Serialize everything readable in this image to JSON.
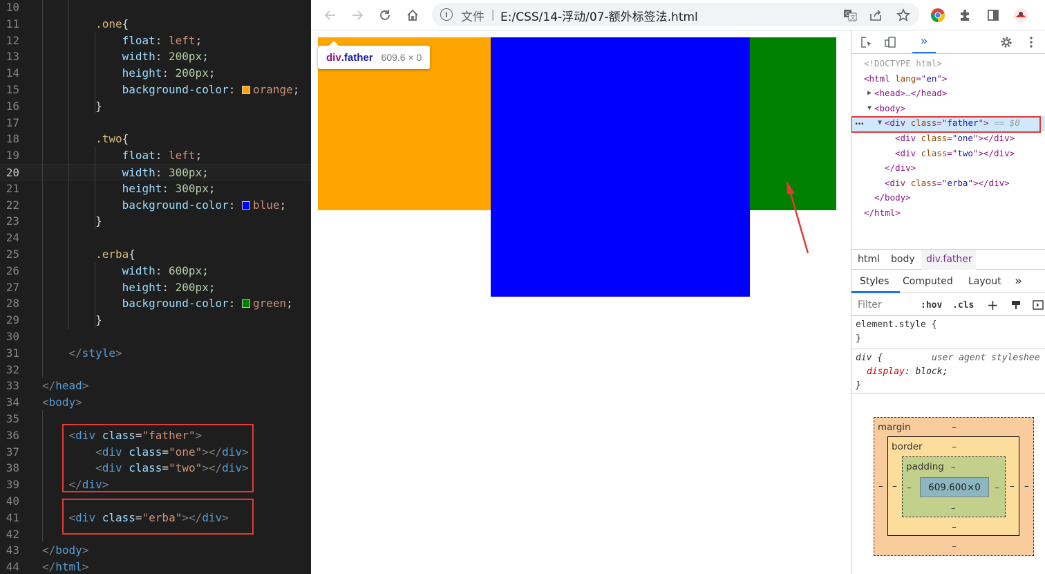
{
  "editor": {
    "lines": [
      {
        "n": "10",
        "tokens": []
      },
      {
        "n": "11",
        "tokens": [
          [
            "sel",
            "        .one"
          ],
          [
            "p",
            "{"
          ]
        ]
      },
      {
        "n": "12",
        "tokens": [
          [
            "prop",
            "            float"
          ],
          [
            "p",
            ": "
          ],
          [
            "val",
            "left"
          ],
          [
            "p",
            ";"
          ]
        ]
      },
      {
        "n": "13",
        "tokens": [
          [
            "prop",
            "            width"
          ],
          [
            "p",
            ": "
          ],
          [
            "num",
            "200px"
          ],
          [
            "p",
            ";"
          ]
        ]
      },
      {
        "n": "14",
        "tokens": [
          [
            "prop",
            "            height"
          ],
          [
            "p",
            ": "
          ],
          [
            "num",
            "200px"
          ],
          [
            "p",
            ";"
          ]
        ]
      },
      {
        "n": "15",
        "tokens": [
          [
            "prop",
            "            background-color"
          ],
          [
            "p",
            ": "
          ],
          [
            "swatch",
            "#ffa500"
          ],
          [
            "val",
            "orange"
          ],
          [
            "p",
            ";"
          ]
        ]
      },
      {
        "n": "16",
        "tokens": [
          [
            "p",
            "        }"
          ]
        ]
      },
      {
        "n": "17",
        "tokens": []
      },
      {
        "n": "18",
        "tokens": [
          [
            "sel",
            "        .two"
          ],
          [
            "p",
            "{"
          ]
        ]
      },
      {
        "n": "19",
        "tokens": [
          [
            "prop",
            "            float"
          ],
          [
            "p",
            ": "
          ],
          [
            "val",
            "left"
          ],
          [
            "p",
            ";"
          ]
        ]
      },
      {
        "n": "20",
        "tokens": [
          [
            "prop",
            "            width"
          ],
          [
            "p",
            ": "
          ],
          [
            "num",
            "300px"
          ],
          [
            "p",
            ";"
          ]
        ],
        "active": true
      },
      {
        "n": "21",
        "tokens": [
          [
            "prop",
            "            height"
          ],
          [
            "p",
            ": "
          ],
          [
            "num",
            "300px"
          ],
          [
            "p",
            ";"
          ]
        ]
      },
      {
        "n": "22",
        "tokens": [
          [
            "prop",
            "            background-color"
          ],
          [
            "p",
            ": "
          ],
          [
            "swatch",
            "#0000ff"
          ],
          [
            "val",
            "blue"
          ],
          [
            "p",
            ";"
          ]
        ]
      },
      {
        "n": "23",
        "tokens": [
          [
            "p",
            "        }"
          ]
        ]
      },
      {
        "n": "24",
        "tokens": []
      },
      {
        "n": "25",
        "tokens": [
          [
            "sel",
            "        .erba"
          ],
          [
            "p",
            "{"
          ]
        ]
      },
      {
        "n": "26",
        "tokens": [
          [
            "prop",
            "            width"
          ],
          [
            "p",
            ": "
          ],
          [
            "num",
            "600px"
          ],
          [
            "p",
            ";"
          ]
        ]
      },
      {
        "n": "27",
        "tokens": [
          [
            "prop",
            "            height"
          ],
          [
            "p",
            ": "
          ],
          [
            "num",
            "200px"
          ],
          [
            "p",
            ";"
          ]
        ]
      },
      {
        "n": "28",
        "tokens": [
          [
            "prop",
            "            background-color"
          ],
          [
            "p",
            ": "
          ],
          [
            "swatch",
            "#008000"
          ],
          [
            "val",
            "green"
          ],
          [
            "p",
            ";"
          ]
        ]
      },
      {
        "n": "29",
        "tokens": [
          [
            "p",
            "        }"
          ]
        ]
      },
      {
        "n": "30",
        "tokens": []
      },
      {
        "n": "31",
        "tokens": [
          [
            "br",
            "    </"
          ],
          [
            "tag",
            "style"
          ],
          [
            "br",
            ">"
          ]
        ]
      },
      {
        "n": "32",
        "tokens": []
      },
      {
        "n": "33",
        "tokens": [
          [
            "br",
            "</"
          ],
          [
            "tag",
            "head"
          ],
          [
            "br",
            ">"
          ]
        ]
      },
      {
        "n": "34",
        "tokens": [
          [
            "br",
            "<"
          ],
          [
            "tag",
            "body"
          ],
          [
            "br",
            ">"
          ]
        ]
      },
      {
        "n": "35",
        "tokens": []
      },
      {
        "n": "36",
        "tokens": [
          [
            "br",
            "    <"
          ],
          [
            "tag",
            "div"
          ],
          [
            "p",
            " "
          ],
          [
            "attr",
            "class"
          ],
          [
            "p",
            "="
          ],
          [
            "str",
            "\"father\""
          ],
          [
            "br",
            ">"
          ]
        ]
      },
      {
        "n": "37",
        "tokens": [
          [
            "br",
            "        <"
          ],
          [
            "tag",
            "div"
          ],
          [
            "p",
            " "
          ],
          [
            "attr",
            "class"
          ],
          [
            "p",
            "="
          ],
          [
            "str",
            "\"one\""
          ],
          [
            "br",
            "></"
          ],
          [
            "tag",
            "div"
          ],
          [
            "br",
            ">"
          ]
        ]
      },
      {
        "n": "38",
        "tokens": [
          [
            "br",
            "        <"
          ],
          [
            "tag",
            "div"
          ],
          [
            "p",
            " "
          ],
          [
            "attr",
            "class"
          ],
          [
            "p",
            "="
          ],
          [
            "str",
            "\"two\""
          ],
          [
            "br",
            "></"
          ],
          [
            "tag",
            "div"
          ],
          [
            "br",
            ">"
          ]
        ]
      },
      {
        "n": "39",
        "tokens": [
          [
            "br",
            "    </"
          ],
          [
            "tag",
            "div"
          ],
          [
            "br",
            ">"
          ]
        ]
      },
      {
        "n": "40",
        "tokens": []
      },
      {
        "n": "41",
        "tokens": [
          [
            "br",
            "    <"
          ],
          [
            "tag",
            "div"
          ],
          [
            "p",
            " "
          ],
          [
            "attr",
            "class"
          ],
          [
            "p",
            "="
          ],
          [
            "str",
            "\"erba\""
          ],
          [
            "br",
            "></"
          ],
          [
            "tag",
            "div"
          ],
          [
            "br",
            ">"
          ]
        ]
      },
      {
        "n": "42",
        "tokens": []
      },
      {
        "n": "43",
        "tokens": [
          [
            "br",
            "</"
          ],
          [
            "tag",
            "body"
          ],
          [
            "br",
            ">"
          ]
        ]
      },
      {
        "n": "44",
        "tokens": [
          [
            "br",
            "</"
          ],
          [
            "tag",
            "html"
          ],
          [
            "br",
            ">"
          ]
        ]
      }
    ]
  },
  "browser": {
    "file_label": "文件",
    "separator": "|",
    "url": "E:/CSS/14-浮动/07-额外标签法.html",
    "icons": [
      "back-icon",
      "forward-icon",
      "reload-icon",
      "home-icon",
      "info-icon",
      "translate-icon",
      "share-icon",
      "bookmark-star-icon",
      "chrome-icon",
      "extensions-icon",
      "side-panel-icon",
      "profile-avatar-icon"
    ]
  },
  "page": {
    "boxes": {
      "one": {
        "color": "#ffa500"
      },
      "two": {
        "color": "#0000ff"
      },
      "erba": {
        "color": "#008000"
      }
    },
    "tooltip": {
      "tag": "div",
      "cls": ".father",
      "dims": "609.6 × 0"
    },
    "arrow_color": "#e53935"
  },
  "devtools": {
    "elements": [
      {
        "indent": 0,
        "parts": [
          [
            "doc",
            "<!DOCTYPE html>"
          ]
        ]
      },
      {
        "indent": 0,
        "parts": [
          [
            "tag",
            "<html "
          ],
          [
            "attr",
            "lang"
          ],
          [
            "tag",
            "=\""
          ],
          [
            "aval",
            "en"
          ],
          [
            "tag",
            "\">"
          ]
        ]
      },
      {
        "indent": 1,
        "tri": "▶",
        "parts": [
          [
            "tag",
            "<head>"
          ],
          [
            "doc",
            "…"
          ],
          [
            "tag",
            "</head>"
          ]
        ]
      },
      {
        "indent": 1,
        "tri": "▼",
        "parts": [
          [
            "tag",
            "<body>"
          ]
        ]
      },
      {
        "indent": 2,
        "tri": "▼",
        "parts": [
          [
            "tag",
            "<div "
          ],
          [
            "attr",
            "class"
          ],
          [
            "tag",
            "=\""
          ],
          [
            "aval",
            "father"
          ],
          [
            "tag",
            "\">"
          ],
          [
            "doc",
            " == $0"
          ]
        ],
        "selected": true
      },
      {
        "indent": 3,
        "parts": [
          [
            "tag",
            "<div "
          ],
          [
            "attr",
            "class"
          ],
          [
            "tag",
            "=\""
          ],
          [
            "aval",
            "one"
          ],
          [
            "tag",
            "\"></div>"
          ]
        ]
      },
      {
        "indent": 3,
        "parts": [
          [
            "tag",
            "<div "
          ],
          [
            "attr",
            "class"
          ],
          [
            "tag",
            "=\""
          ],
          [
            "aval",
            "two"
          ],
          [
            "tag",
            "\"></div>"
          ]
        ]
      },
      {
        "indent": 2,
        "parts": [
          [
            "tag",
            "</div>"
          ]
        ]
      },
      {
        "indent": 2,
        "parts": [
          [
            "tag",
            "<div "
          ],
          [
            "attr",
            "class"
          ],
          [
            "tag",
            "=\""
          ],
          [
            "aval",
            "erba"
          ],
          [
            "tag",
            "\"></div>"
          ]
        ]
      },
      {
        "indent": 1,
        "parts": [
          [
            "tag",
            "</body>"
          ]
        ]
      },
      {
        "indent": 0,
        "parts": [
          [
            "tag",
            "</html>"
          ]
        ]
      }
    ],
    "ellipsis": "…",
    "breadcrumbs": [
      "html",
      "body",
      "div.father"
    ],
    "subtabs": [
      "Styles",
      "Computed",
      "Layout",
      "»"
    ],
    "filter_placeholder": "Filter",
    "hov": ":hov",
    "cls": ".cls",
    "rules": {
      "element_style_open": "element.style {",
      "element_style_close": "}",
      "div_selector": "div {",
      "div_source": "user agent styleshee",
      "div_prop": "display",
      "div_val": "block;",
      "div_close": "}"
    },
    "box_model": {
      "margin_label": "margin",
      "border_label": "border",
      "padding_label": "padding",
      "dash": "–",
      "content": "609.600×0"
    }
  }
}
